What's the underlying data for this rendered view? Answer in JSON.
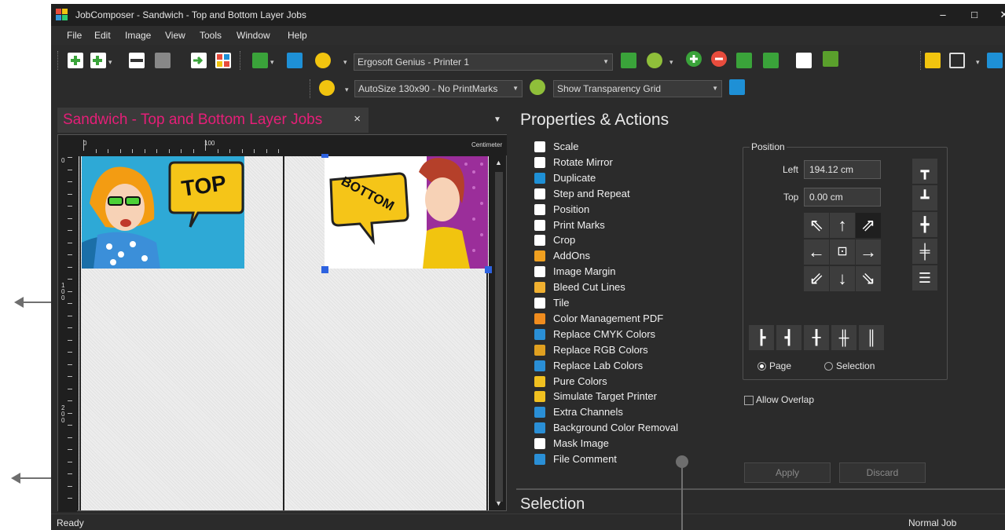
{
  "window": {
    "title": "JobComposer - Sandwich - Top and Bottom Layer Jobs",
    "minimize": "–",
    "maximize": "□",
    "close": "✕"
  },
  "menu": [
    "File",
    "Edit",
    "Image",
    "View",
    "Tools",
    "Window",
    "Help"
  ],
  "toolbar": {
    "printer_select": "Ergosoft Genius - Printer 1",
    "size_select": "AutoSize 130x90 - No PrintMarks",
    "transparency_select": "Show Transparency Grid"
  },
  "document_tab": {
    "label": "Sandwich - Top and Bottom Layer Jobs",
    "close": "×"
  },
  "canvas": {
    "ruler_unit": "Centimeter",
    "ruler_top_labels": [
      "0",
      "100"
    ],
    "ruler_left_labels": [
      "0",
      "100",
      "200"
    ],
    "image_top_text": "TOP",
    "image_bottom_text": "BOTTOM"
  },
  "properties": {
    "title": "Properties & Actions",
    "actions": [
      {
        "label": "Scale",
        "icon": "scale-icon",
        "color": "#ffffff"
      },
      {
        "label": "Rotate Mirror",
        "icon": "rotate-icon",
        "color": "#ffffff"
      },
      {
        "label": "Duplicate",
        "icon": "duplicate-icon",
        "color": "#1e90d6"
      },
      {
        "label": "Step and Repeat",
        "icon": "step-repeat-icon",
        "color": "#ffffff"
      },
      {
        "label": "Position",
        "icon": "position-icon",
        "color": "#ffffff"
      },
      {
        "label": "Print Marks",
        "icon": "print-marks-icon",
        "color": "#ffffff"
      },
      {
        "label": "Crop",
        "icon": "crop-icon",
        "color": "#ffffff"
      },
      {
        "label": "AddOns",
        "icon": "addons-icon",
        "color": "#f0a020"
      },
      {
        "label": "Image Margin",
        "icon": "image-margin-icon",
        "color": "#ffffff"
      },
      {
        "label": "Bleed Cut Lines",
        "icon": "bleed-icon",
        "color": "#f0b030"
      },
      {
        "label": "Tile",
        "icon": "tile-icon",
        "color": "#ffffff"
      },
      {
        "label": "Color Management PDF",
        "icon": "color-management-icon",
        "color": "#f08c1e"
      },
      {
        "label": "Replace CMYK Colors",
        "icon": "replace-cmyk-icon",
        "color": "#2a8fd6"
      },
      {
        "label": "Replace RGB Colors",
        "icon": "replace-rgb-icon",
        "color": "#e0a020"
      },
      {
        "label": "Replace Lab Colors",
        "icon": "replace-lab-icon",
        "color": "#2a8fd6"
      },
      {
        "label": "Pure Colors",
        "icon": "pure-colors-icon",
        "color": "#f0c020"
      },
      {
        "label": "Simulate Target Printer",
        "icon": "simulate-printer-icon",
        "color": "#f0c020"
      },
      {
        "label": "Extra Channels",
        "icon": "extra-channels-icon",
        "color": "#2a8fd6"
      },
      {
        "label": "Background Color Removal",
        "icon": "bg-removal-icon",
        "color": "#2a8fd6"
      },
      {
        "label": "Mask Image",
        "icon": "mask-icon",
        "color": "#ffffff"
      },
      {
        "label": "File Comment",
        "icon": "file-comment-icon",
        "color": "#2a8fd6"
      }
    ]
  },
  "position": {
    "group_label": "Position",
    "left_label": "Left",
    "left_value": "194.12 cm",
    "top_label": "Top",
    "top_value": "0.00 cm",
    "radio_page": "Page",
    "radio_selection": "Selection",
    "allow_overlap": "Allow Overlap",
    "apply": "Apply",
    "discard": "Discard"
  },
  "selection": {
    "title": "Selection"
  },
  "status": {
    "left": "Ready",
    "right": "Normal Job"
  }
}
